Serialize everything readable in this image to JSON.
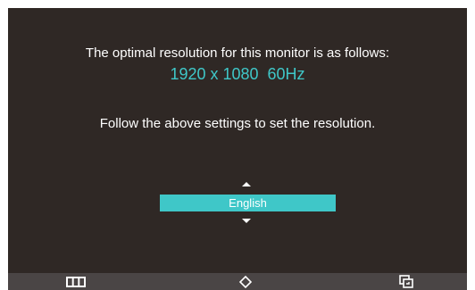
{
  "message": {
    "line1": "The optimal resolution for this monitor is as follows:",
    "resolution": "1920 x 1080  60Hz",
    "line3": "Follow the above settings to set the resolution."
  },
  "language_selector": {
    "selected": "English"
  },
  "bottom_bar": {
    "buttons": [
      {
        "icon": "menu-icon"
      },
      {
        "icon": "up-down-icon"
      },
      {
        "icon": "source-icon"
      }
    ]
  },
  "colors": {
    "background": "#2f2825",
    "accent": "#3fc7c8",
    "bottom_bar": "#4a4545",
    "text": "#ffffff"
  }
}
